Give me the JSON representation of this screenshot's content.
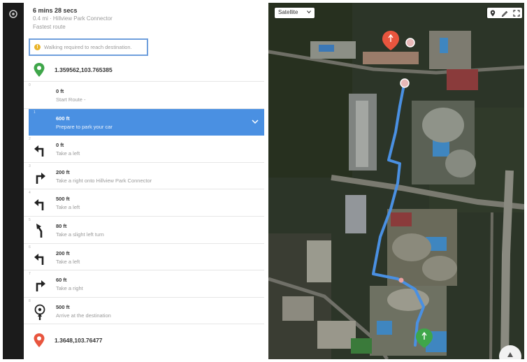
{
  "summary": {
    "duration": "6 mins 28 secs",
    "distance_via": "0.4 mi · Hillview Park Connector",
    "route_type": "Fastest route",
    "warning": "Walking required to reach destination."
  },
  "origin": {
    "coords": "1.359562,103.765385",
    "icon": "green-location-pin"
  },
  "destination": {
    "coords": "1.3648,103.76477",
    "icon": "red-location-pin"
  },
  "steps": [
    {
      "index": "0",
      "distance": "0 ft",
      "instruction": "Start Route -",
      "icon": "none"
    },
    {
      "index": "1",
      "distance": "600 ft",
      "instruction": "Prepare to park your car",
      "icon": "none",
      "active": true
    },
    {
      "index": "2",
      "distance": "0 ft",
      "instruction": "Take a left",
      "icon": "turn-left"
    },
    {
      "index": "3",
      "distance": "200 ft",
      "instruction": "Take a right onto Hillview Park Connector",
      "icon": "turn-right"
    },
    {
      "index": "4",
      "distance": "500 ft",
      "instruction": "Take a left",
      "icon": "turn-left"
    },
    {
      "index": "5",
      "distance": "80 ft",
      "instruction": "Take a slight left turn",
      "icon": "slight-left"
    },
    {
      "index": "6",
      "distance": "200 ft",
      "instruction": "Take a left",
      "icon": "turn-left"
    },
    {
      "index": "7",
      "distance": "60 ft",
      "instruction": "Take a right",
      "icon": "turn-right"
    },
    {
      "index": "8",
      "distance": "500 ft",
      "instruction": "Arrive at the destination",
      "icon": "arrive"
    }
  ],
  "map": {
    "type_selected": "Satellite",
    "tools": [
      "pin-icon",
      "pencil-icon",
      "fullscreen-icon"
    ],
    "route_color": "#4a90e2"
  },
  "colors": {
    "accent": "#4a90e2",
    "origin_pin": "#3fa64a",
    "destination_pin": "#e8553e",
    "warning": "#e9b42a"
  }
}
